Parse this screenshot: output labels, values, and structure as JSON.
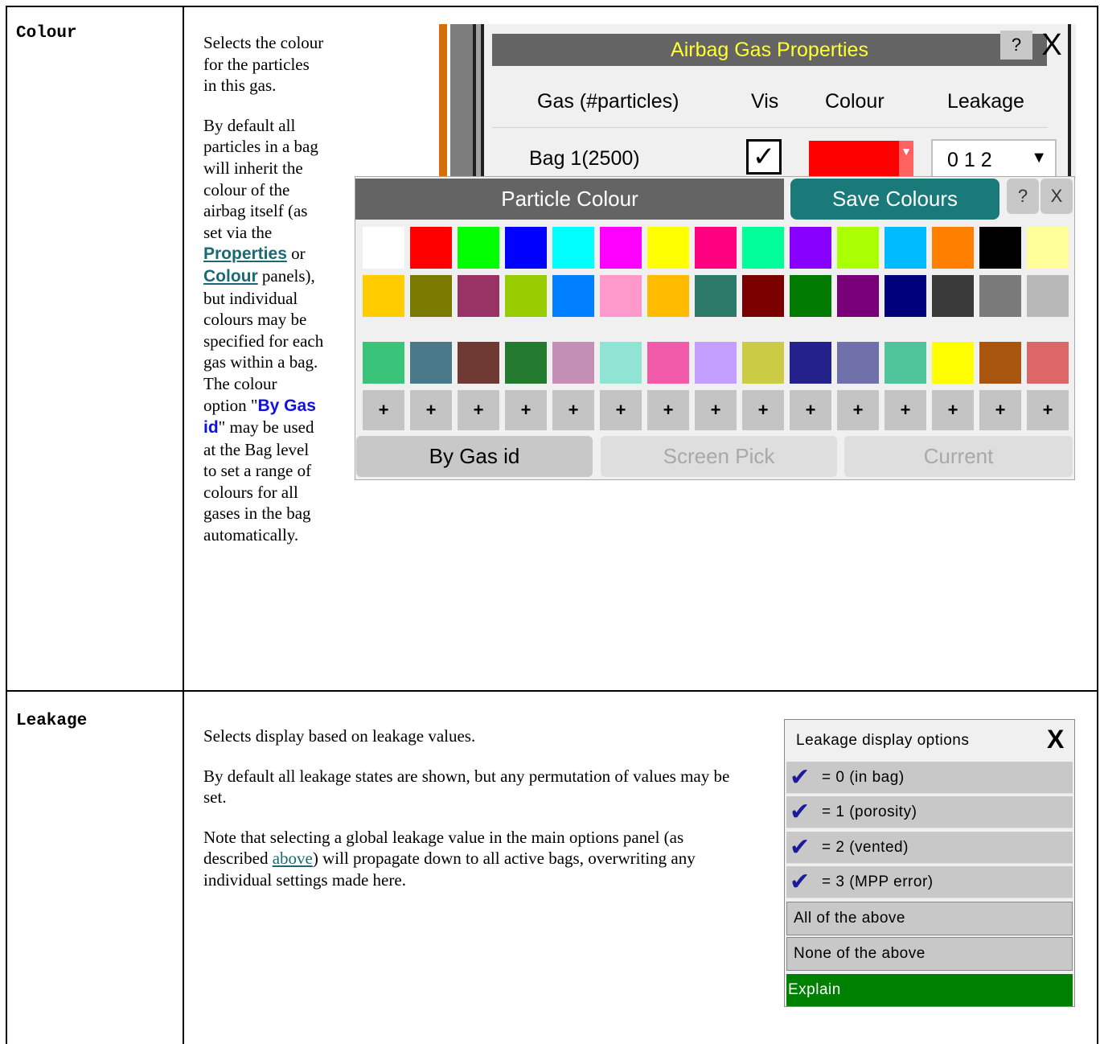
{
  "rows": [
    {
      "term": "Colour",
      "description": {
        "p1": "Selects the colour for the particles in this gas.",
        "p2_a": "By default all particles in a bag will inherit the colour of the airbag itself (as set via the ",
        "p2_link1": "Properties",
        "p2_b": " or ",
        "p2_link2": "Colour",
        "p2_c": " panels), but individual colours may be specified for each gas within a bag. The colour option \"",
        "p2_kw": "By Gas id",
        "p2_d": "\" may be used at the Bag level to set a range of colours for all gases in the bag automatically."
      }
    },
    {
      "term": "Leakage",
      "description": {
        "p1": "Selects display based on leakage values.",
        "p2": "By default all leakage states are shown, but any permutation of values may be set.",
        "p3_a": "Note that selecting a global leakage value in the main options panel (as described ",
        "p3_link": "above",
        "p3_b": ") will propagate down to all active bags, overwriting any individual settings made here."
      }
    }
  ],
  "gas_panel": {
    "title": "Airbag Gas Properties",
    "help": "?",
    "close": "X",
    "headers": {
      "gas": "Gas (#particles)",
      "vis": "Vis",
      "colour": "Colour",
      "leakage": "Leakage"
    },
    "row": {
      "bag": "Bag 1(2500)",
      "vis_checked": true,
      "check": "✓",
      "colour": "#ff0000",
      "leakage": "0 1 2",
      "arrow": "▼",
      "colour_arrow": "▼"
    }
  },
  "particle_colour": {
    "title": "Particle Colour",
    "save": "Save Colours",
    "help": "?",
    "close": "X",
    "swatches_row1": [
      "#ffffff",
      "#ff0000",
      "#00ff00",
      "#0000ff",
      "#00ffff",
      "#ff00ff",
      "#ffff00",
      "#ff0080",
      "#00ff99",
      "#8800ff",
      "#aaff00",
      "#00bbff",
      "#ff8000",
      "#000000",
      "#ffff99"
    ],
    "swatches_row2": [
      "#ffcc00",
      "#7a7a00",
      "#993366",
      "#99cc00",
      "#0080ff",
      "#ff99cc",
      "#ffbb00",
      "#2e7a6a",
      "#7a0000",
      "#007a00",
      "#7a007a",
      "#00007a",
      "#3a3a3a",
      "#7a7a7a",
      "#b8b8b8"
    ],
    "swatches_row3": [
      "#3ac47a",
      "#4a7a8a",
      "#6e3a33",
      "#237a2e",
      "#c48fb5",
      "#8fe4d4",
      "#f05aa8",
      "#c49fff",
      "#cccc44",
      "#22228a",
      "#7070aa",
      "#50c49a",
      "#ffff00",
      "#a8560f",
      "#dd6666"
    ],
    "plus": "+",
    "buttons": {
      "by_gas": "By Gas id",
      "screen_pick": "Screen Pick",
      "current": "Current"
    }
  },
  "leakage_panel": {
    "title": "Leakage display options",
    "close": "X",
    "tick": "✔",
    "options": [
      "= 0 (in bag)",
      "= 1 (porosity)",
      "= 2 (vented)",
      "= 3 (MPP error)"
    ],
    "all": "All of the above",
    "none": "None of the above",
    "explain": "Explain"
  }
}
